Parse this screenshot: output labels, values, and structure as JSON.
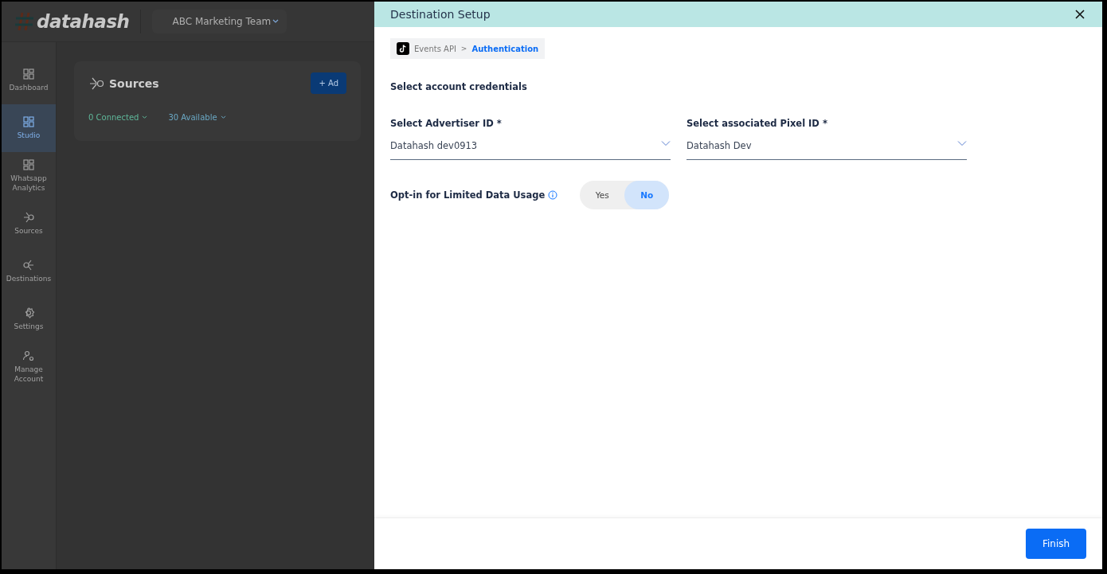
{
  "app": {
    "logo": "datahash",
    "workspace": "ABC Marketing Team",
    "sidebar": {
      "items": [
        {
          "label": "Dashboard",
          "kind": "grid",
          "selected": false
        },
        {
          "label": "Studio",
          "kind": "grid",
          "selected": true
        },
        {
          "label": "Whatsapp Analytics",
          "kind": "grid",
          "selected": false
        },
        {
          "label": "Sources",
          "kind": "sources",
          "selected": false
        },
        {
          "label": "Destinations",
          "kind": "destinations",
          "selected": false
        },
        {
          "label": "Settings",
          "kind": "gear",
          "selected": false
        },
        {
          "label": "Manage Account",
          "kind": "user",
          "selected": false
        }
      ]
    },
    "page": {
      "title": "Sources",
      "add_button": "+ Ad",
      "filters": [
        {
          "label": "0 Connected",
          "color": "#5fb89a"
        },
        {
          "label": "30 Available",
          "color": "#6aa8c4"
        }
      ]
    }
  },
  "drawer": {
    "title": "Destination Setup",
    "breadcrumb": [
      {
        "label": "Events API",
        "selected": false
      },
      {
        "label": "Authentication",
        "selected": true
      }
    ],
    "separator": ">",
    "section_title": "Select account credentials",
    "fields": [
      {
        "label": "Select Advertiser ID *",
        "value": "Datahash dev0913"
      },
      {
        "label": "Select associated Pixel ID *",
        "value": "Datahash Dev"
      }
    ],
    "opt_in": {
      "label": "Opt-in for Limited Data Usage",
      "options": [
        {
          "label": "Yes",
          "selected": false
        },
        {
          "label": "No",
          "selected": true
        }
      ]
    },
    "finish_button": "Finish"
  }
}
